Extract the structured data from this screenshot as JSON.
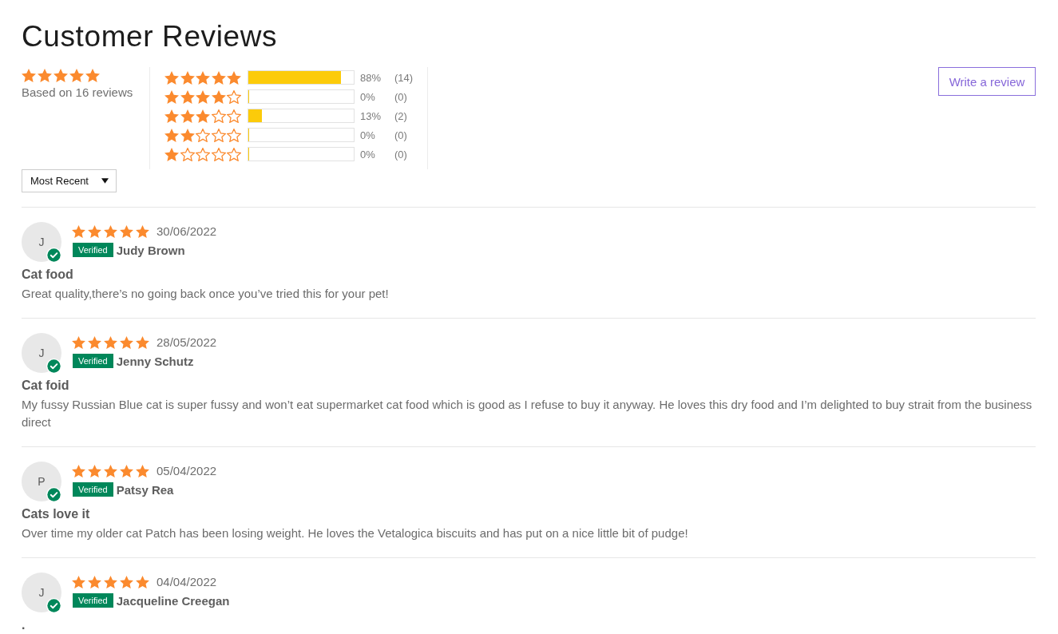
{
  "title": "Customer Reviews",
  "summary": {
    "stars": 5,
    "caption": "Based on 16 reviews"
  },
  "histogram": [
    {
      "stars": 5,
      "level": 0.88,
      "percent": "88%",
      "count": "(14)"
    },
    {
      "stars": 4,
      "level": 0,
      "percent": "0%",
      "count": "(0)"
    },
    {
      "stars": 3,
      "level": 0.13,
      "percent": "13%",
      "count": "(2)"
    },
    {
      "stars": 2,
      "level": 0,
      "percent": "0%",
      "count": "(0)"
    },
    {
      "stars": 1,
      "level": 0,
      "percent": "0%",
      "count": "(0)"
    }
  ],
  "write_review_button": {
    "label": "Write a review"
  },
  "sort_dropdown": {
    "value": "Most Recent"
  },
  "reviews": [
    {
      "initial": "J",
      "verified": true,
      "stars": 5,
      "date": "30/06/2022",
      "badge": "Verified",
      "author": "Judy Brown",
      "title": "Cat food",
      "body": "Great quality,there’s no going back once you’ve tried this for your pet!"
    },
    {
      "initial": "J",
      "verified": true,
      "stars": 5,
      "date": "28/05/2022",
      "badge": "Verified",
      "author": "Jenny Schutz",
      "title": "Cat foid",
      "body": "My fussy Russian Blue cat is super fussy and won’t eat supermarket cat food which is good as I refuse to buy it anyway. He loves this dry food and I’m delighted to buy strait from the business direct"
    },
    {
      "initial": "P",
      "verified": true,
      "stars": 5,
      "date": "05/04/2022",
      "badge": "Verified",
      "author": "Patsy Rea",
      "title": "Cats love it",
      "body": "Over time my older cat Patch has been losing weight. He loves the Vetalogica biscuits and has put on a nice little bit of pudge!"
    },
    {
      "initial": "J",
      "verified": true,
      "stars": 5,
      "date": "04/04/2022",
      "badge": "Verified",
      "author": "Jacqueline Creegan",
      "title": "."
    }
  ]
}
